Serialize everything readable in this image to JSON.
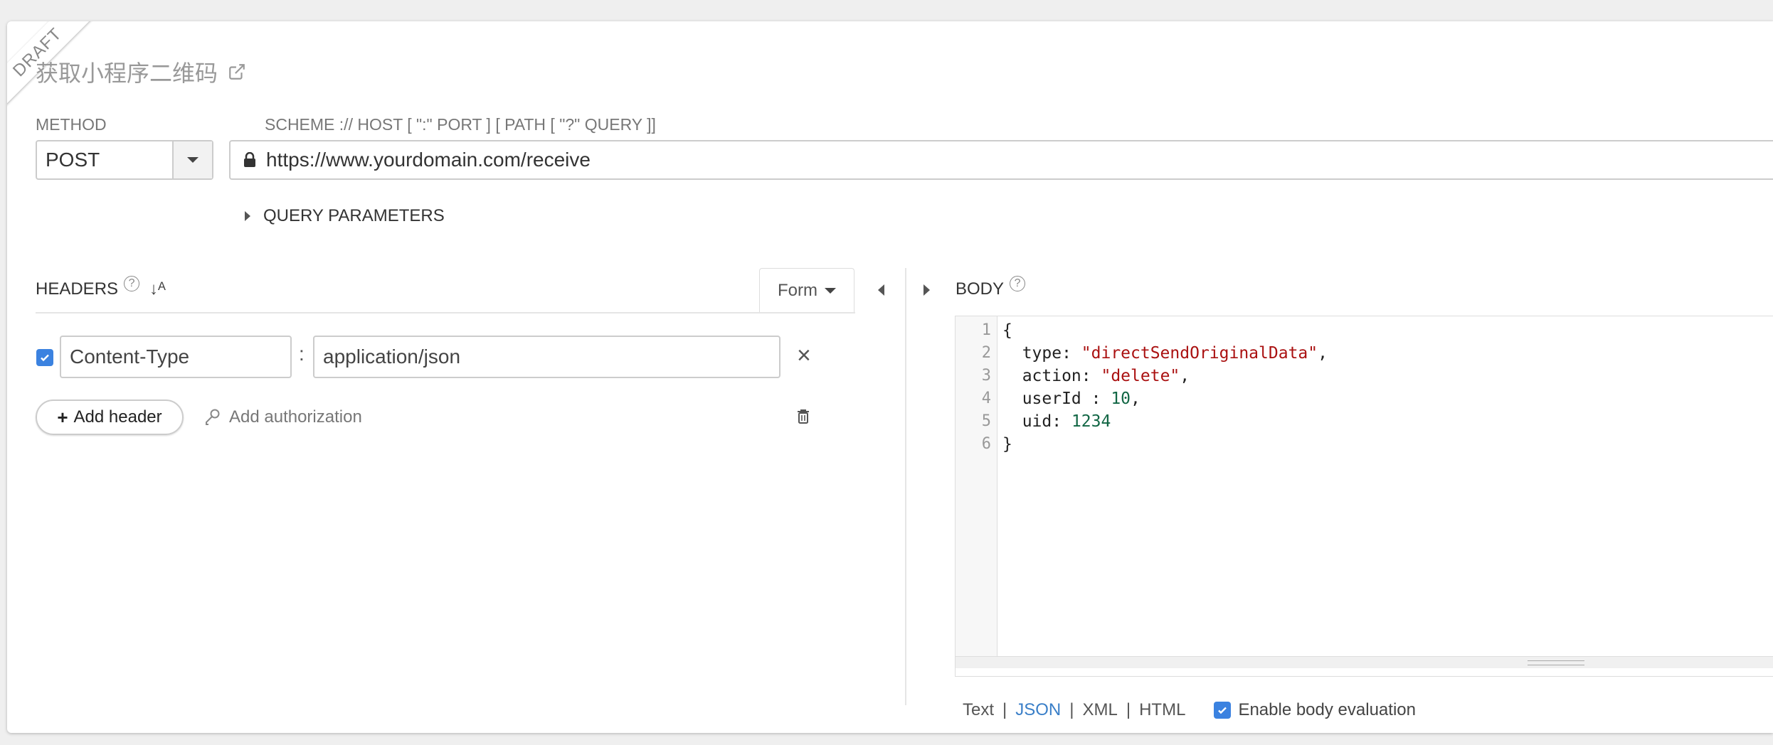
{
  "request": {
    "status_ribbon": "DRAFT",
    "title": "获取小程序二维码",
    "method_label": "METHOD",
    "method_value": "POST",
    "url_label": "SCHEME :// HOST [ \":\" PORT ] [ PATH [ \"?\" QUERY ]]",
    "url_value": "https://www.yourdomain.com/receive",
    "query_params_label": "QUERY PARAMETERS"
  },
  "headers": {
    "title": "HEADERS",
    "mode_button": "Form",
    "items": [
      {
        "enabled": true,
        "name": "Content-Type",
        "value": "application/json"
      }
    ],
    "add_header_label": "Add header",
    "add_auth_label": "Add authorization"
  },
  "body": {
    "title": "BODY",
    "line_numbers": [
      "1",
      "2",
      "3",
      "4",
      "5",
      "6"
    ],
    "code_lines": [
      {
        "pre": "{",
        "str": "",
        "post": ""
      },
      {
        "pre": "  type: ",
        "str": "\"directSendOriginalData\"",
        "post": ","
      },
      {
        "pre": "  action: ",
        "str": "\"delete\"",
        "post": ","
      },
      {
        "pre": "  userId : ",
        "num": "10",
        "post": ","
      },
      {
        "pre": "  uid: ",
        "num": "1234",
        "post": ""
      },
      {
        "pre": "}",
        "str": "",
        "post": ""
      }
    ],
    "formats": [
      "Text",
      "JSON",
      "XML",
      "HTML"
    ],
    "active_format": "JSON",
    "evaluation_label": "Enable body evaluation",
    "evaluation_enabled": true
  },
  "icons": {
    "external_link": "external-link-icon",
    "lock": "lock-icon",
    "help": "help-icon",
    "sort": "sort-alpha-icon",
    "close": "close-icon",
    "key": "key-icon",
    "trash": "trash-icon"
  },
  "colors": {
    "accent": "#3b82e0",
    "link_active": "#3a7fc8",
    "string": "#aa1111",
    "number": "#116644"
  }
}
